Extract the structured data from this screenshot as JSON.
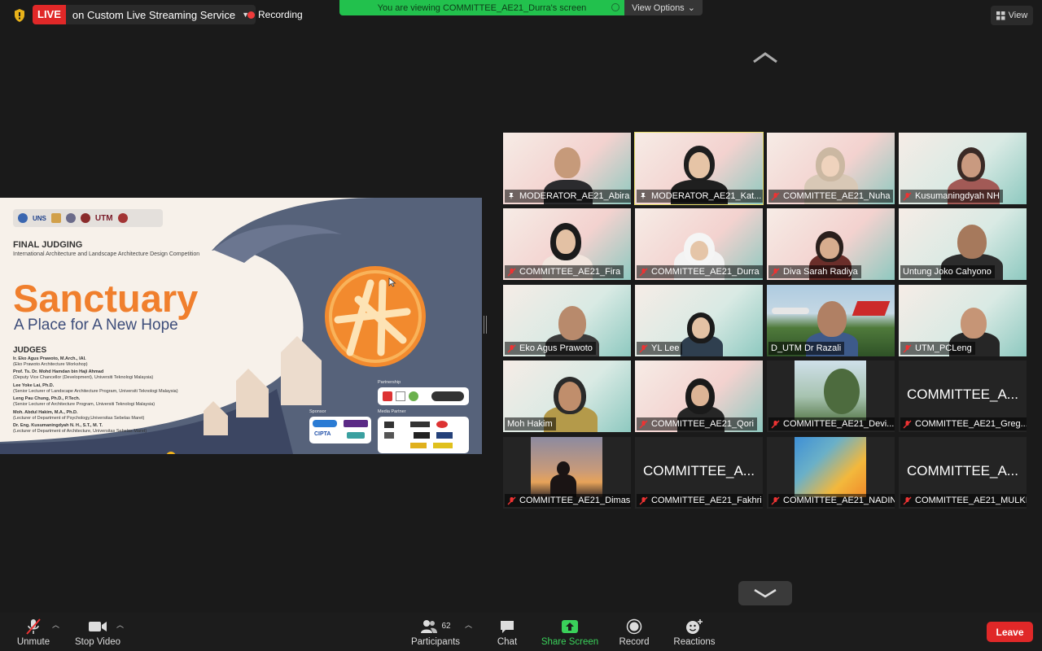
{
  "topbar": {
    "live_badge": "LIVE",
    "live_service": "on Custom Live Streaming Service",
    "recording": "Recording",
    "viewing_banner": "You are viewing COMMITTEE_AE21_Durra's screen",
    "view_options": "View Options",
    "view": "View"
  },
  "slide": {
    "logos": [
      "UNS",
      "UTM"
    ],
    "final_judging": "FINAL JUDGING",
    "competition": "International Architecture and Landscape Architecture Design Competition",
    "title": "Sanctuary",
    "subtitle": "A Place for A New Hope",
    "judges_title": "JUDGES",
    "judges": [
      {
        "name": "Ir. Eko Agus Prawoto, M.Arch., IAI.",
        "role": "(Eko Prawoto Architecture Workshop)"
      },
      {
        "name": "Prof. Ts. Dr. Mohd Hamdan bin Haji Ahmad",
        "role": "(Deputy Vice Chancellor (Development), Universiti Teknologi Malaysia)"
      },
      {
        "name": "Lee Yoke Lai, Ph.D.",
        "role": "(Senior Lecturer of Landscape Architecture Program, Universiti Teknologi Malaysia)"
      },
      {
        "name": "Leng Pau Chung, Ph.D., P.Tech.",
        "role": "(Senior Lecturer of Architecture Program, Universiti Teknologi Malaysia)"
      },
      {
        "name": "Moh. Abdul Hakim, M.A., Ph.D.",
        "role": "(Lecturer of Department of Psychology,Universitas Sebelas Maret)"
      },
      {
        "name": "Dr. Eng. Kusumaningdyah N. H., S.T., M. T.",
        "role": "(Lecturer of Department of Architecture, Universitas Sebelas Maret)"
      }
    ],
    "partnership": "Partnership",
    "sponsor": "Sponsor",
    "media_partner": "Media Partner",
    "sponsor_names": [
      "CIPTA"
    ],
    "accent_orange": "#f07f2d",
    "accent_navy": "#3d4d7a"
  },
  "participants": [
    {
      "name": "MODERATOR_AE21_Abira",
      "type": "video",
      "pinned": true
    },
    {
      "name": "MODERATOR_AE21_Kat...",
      "type": "video",
      "pinned": true,
      "active_speaker": true
    },
    {
      "name": "COMMITTEE_AE21_Nuha",
      "type": "video",
      "muted": true
    },
    {
      "name": "Kusumaningdyah NH",
      "type": "video",
      "muted": true
    },
    {
      "name": "COMMITTEE_AE21_Fira",
      "type": "video",
      "muted": true
    },
    {
      "name": "COMMITTEE_AE21_Durra",
      "type": "video",
      "muted": true
    },
    {
      "name": "Diva Sarah Radiya",
      "type": "video",
      "muted": true
    },
    {
      "name": "Untung Joko Cahyono",
      "type": "video",
      "muted": false
    },
    {
      "name": "Eko Agus Prawoto",
      "type": "video",
      "muted": true
    },
    {
      "name": "YL Lee",
      "type": "video",
      "muted": true
    },
    {
      "name": "D_UTM Dr Razali",
      "type": "video",
      "muted": false
    },
    {
      "name": "UTM_PCLeng",
      "type": "video",
      "muted": true
    },
    {
      "name": "Moh Hakim",
      "type": "video",
      "muted": false
    },
    {
      "name": "COMMITTEE_AE21_Qori",
      "type": "video",
      "muted": true
    },
    {
      "name": "COMMITTEE_AE21_Devi...",
      "type": "photo",
      "muted": true
    },
    {
      "name": "COMMITTEE_AE21_Greg...",
      "type": "text",
      "cover": "COMMITTEE_A...",
      "muted": true
    },
    {
      "name": "COMMITTEE_AE21_Dimas",
      "type": "photo",
      "muted": true
    },
    {
      "name": "COMMITTEE_AE21_Fakhri",
      "type": "text",
      "cover": "COMMITTEE_A...",
      "muted": true
    },
    {
      "name": "COMMITTEE_AE21_NADIN",
      "type": "photo",
      "muted": true
    },
    {
      "name": "COMMITTEE_AE21_MULKI",
      "type": "text",
      "cover": "COMMITTEE_A...",
      "muted": true
    }
  ],
  "toolbar": {
    "unmute": "Unmute",
    "stop_video": "Stop Video",
    "participants": "Participants",
    "participant_count": "62",
    "chat": "Chat",
    "share_screen": "Share Screen",
    "record": "Record",
    "reactions": "Reactions",
    "leave": "Leave"
  },
  "colors": {
    "live_red": "#e02828",
    "banner_green": "#22c14d",
    "share_green": "#3ad15a",
    "active_speaker": "#e6dd6a"
  }
}
